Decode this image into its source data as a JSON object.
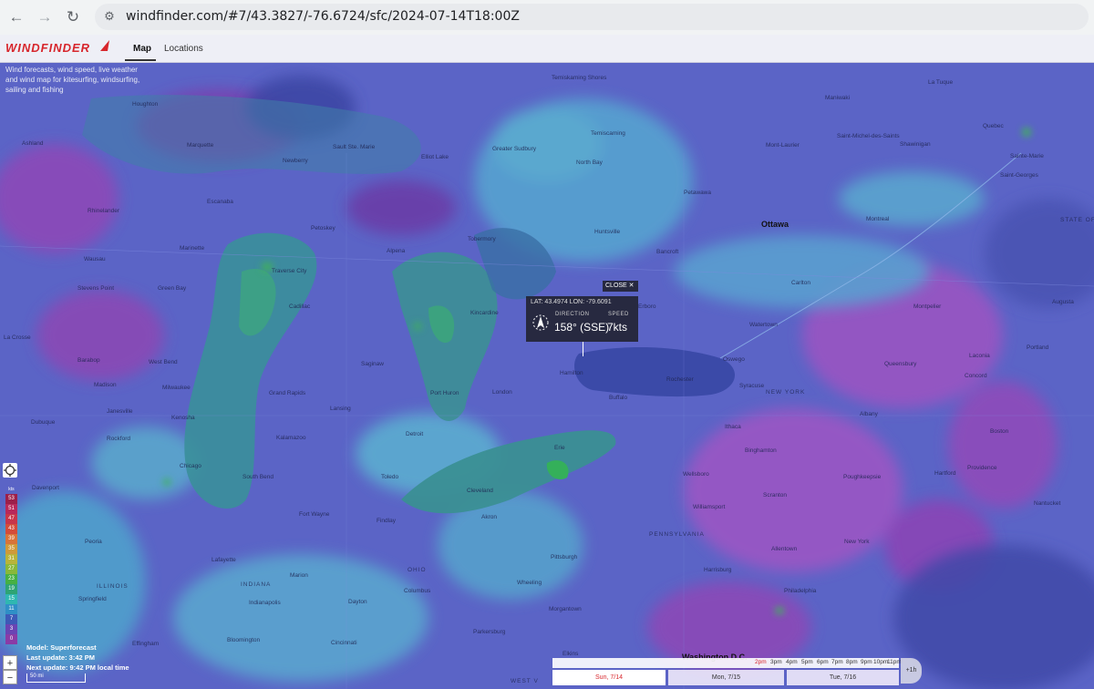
{
  "browser": {
    "back": "←",
    "forward": "→",
    "reload": "↻",
    "url": "windfinder.com/#7/43.3827/-76.6724/sfc/2024-07-14T18:00Z"
  },
  "header": {
    "logo": "WINDFINDER",
    "nav": [
      "Map",
      "Locations"
    ],
    "tagline": "Wind forecasts, wind speed, live weather and wind map for kitesurfing, windsurfing, sailing and fishing"
  },
  "popup": {
    "close": "CLOSE ✕",
    "latlon": "LAT: 43.4974  LON: -79.6091",
    "direction_label": "DIRECTION",
    "speed_label": "SPEED",
    "direction": "158° (SSE)",
    "speed": "7kts"
  },
  "cities": [
    [
      "Houghton",
      145,
      111
    ],
    [
      "Ashland",
      24,
      154
    ],
    [
      "Marquette",
      205,
      156
    ],
    [
      "Newberry",
      310,
      173
    ],
    [
      "Sault Ste. Marie",
      365,
      158
    ],
    [
      "Elliot Lake",
      462,
      169
    ],
    [
      "Greater Sudbury",
      540,
      160
    ],
    [
      "Temiskaming Shores",
      605,
      82
    ],
    [
      "Temiscaming",
      648,
      143
    ],
    [
      "North Bay",
      632,
      175
    ],
    [
      "Mont-Laurier",
      840,
      156
    ],
    [
      "Maniwaki",
      905,
      104
    ],
    [
      "La Tuque",
      1018,
      87
    ],
    [
      "Saint-Michel-des-Saints",
      918,
      146
    ],
    [
      "Shawinigan",
      987,
      155
    ],
    [
      "Quebec",
      1078,
      135
    ],
    [
      "Sainte-Marie",
      1108,
      168
    ],
    [
      "Saint-Georges",
      1097,
      189
    ],
    [
      "Escanaba",
      227,
      218
    ],
    [
      "Rhinelander",
      96,
      228
    ],
    [
      "Petoskey",
      341,
      247
    ],
    [
      "Alpena",
      424,
      272
    ],
    [
      "Tobermory",
      513,
      259
    ],
    [
      "Huntsville",
      652,
      251
    ],
    [
      "Petawawa",
      750,
      208
    ],
    [
      "Bancroft",
      720,
      273
    ],
    [
      "Montreal",
      950,
      237
    ],
    [
      "Marinette",
      197,
      269
    ],
    [
      "Wausau",
      92,
      281
    ],
    [
      "Traverse City",
      298,
      294
    ],
    [
      "Green Bay",
      173,
      313
    ],
    [
      "Stevens Point",
      85,
      313
    ],
    [
      "Cadillac",
      317,
      333
    ],
    [
      "Kincardine",
      516,
      340
    ],
    [
      "Carlton",
      868,
      307
    ],
    [
      "Watertown",
      822,
      353
    ],
    [
      "Montpelier",
      1002,
      333
    ],
    [
      "Augusta",
      1154,
      328
    ],
    [
      "La Crosse",
      4,
      367
    ],
    [
      "Barabop",
      85,
      392
    ],
    [
      "West Bend",
      163,
      394
    ],
    [
      "Saginaw",
      396,
      396
    ],
    [
      "Oswego",
      793,
      391
    ],
    [
      "Laconia",
      1063,
      387
    ],
    [
      "Portland",
      1126,
      378
    ],
    [
      "Rochester",
      731,
      413
    ],
    [
      "Queensbury",
      970,
      396
    ],
    [
      "Hamilton",
      614,
      406
    ],
    [
      "Madison",
      103,
      419
    ],
    [
      "Milwaukee",
      178,
      422
    ],
    [
      "Grand Rapids",
      295,
      428
    ],
    [
      "Port Huron",
      472,
      428
    ],
    [
      "London",
      540,
      427
    ],
    [
      "Buffalo",
      668,
      433
    ],
    [
      "Syracuse",
      811,
      420
    ],
    [
      "Concord",
      1058,
      409
    ],
    [
      "Janesville",
      117,
      448
    ],
    [
      "Kenosha",
      188,
      455
    ],
    [
      "Lansing",
      362,
      445
    ],
    [
      "Ithaca",
      795,
      465
    ],
    [
      "Albany",
      943,
      451
    ],
    [
      "Dubuque",
      34,
      460
    ],
    [
      "Rockford",
      117,
      478
    ],
    [
      "Kalamazoo",
      303,
      477
    ],
    [
      "Detroit",
      445,
      473
    ],
    [
      "Erie",
      608,
      488
    ],
    [
      "Binghamton",
      817,
      491
    ],
    [
      "Boston",
      1086,
      470
    ],
    [
      "Chicago",
      197,
      508
    ],
    [
      "South Bend",
      266,
      520
    ],
    [
      "Toledo",
      418,
      520
    ],
    [
      "Wellsboro",
      749,
      517
    ],
    [
      "Poughkeepsie",
      925,
      520
    ],
    [
      "Hartford",
      1025,
      516
    ],
    [
      "Providence",
      1061,
      510
    ],
    [
      "Davenport",
      35,
      532
    ],
    [
      "Cleveland",
      512,
      535
    ],
    [
      "Scranton",
      837,
      540
    ],
    [
      "Nantucket",
      1134,
      549
    ],
    [
      "Williamsport",
      760,
      553
    ],
    [
      "Fort Wayne",
      328,
      561
    ],
    [
      "Akron",
      528,
      564
    ],
    [
      "Findlay",
      413,
      568
    ],
    [
      "Peoria",
      93,
      591
    ],
    [
      "Allentown",
      846,
      599
    ],
    [
      "New York",
      926,
      591
    ],
    [
      "Pittsburgh",
      604,
      608
    ],
    [
      "Lafayette",
      232,
      611
    ],
    [
      "Marion",
      318,
      628
    ],
    [
      "Harrisburg",
      772,
      622
    ],
    [
      "Wheeling",
      567,
      636
    ],
    [
      "Columbus",
      443,
      645
    ],
    [
      "Philadelphia",
      860,
      645
    ],
    [
      "Springfield",
      86,
      654
    ],
    [
      "Indianapolis",
      273,
      658
    ],
    [
      "Dayton",
      382,
      657
    ],
    [
      "Morgantown",
      602,
      665
    ],
    [
      "Effingham",
      145,
      703
    ],
    [
      "Bloomington",
      249,
      699
    ],
    [
      "Cincinnati",
      363,
      702
    ],
    [
      "Parkersburg",
      519,
      690
    ],
    [
      "Elkins",
      617,
      714
    ],
    [
      "Erboro",
      700,
      333
    ]
  ],
  "big_cities": [
    [
      "Ottawa",
      835,
      241
    ],
    [
      "Washington D.C.",
      748,
      716
    ]
  ],
  "states": [
    [
      "NEW YORK",
      840,
      427
    ],
    [
      "PENNSYLVANIA",
      712,
      583
    ],
    [
      "ILLINOIS",
      106,
      640
    ],
    [
      "INDIANA",
      264,
      638
    ],
    [
      "OHIO",
      447,
      622
    ],
    [
      "STATE OF",
      1163,
      238
    ],
    [
      "WEST V",
      560,
      744
    ]
  ],
  "legend": {
    "unit": "kts",
    "values": [
      "53",
      "51",
      "47",
      "43",
      "39",
      "35",
      "31",
      "27",
      "23",
      "19",
      "15",
      "11",
      "7",
      "3",
      "0"
    ],
    "colors": [
      "#9c1f4a",
      "#b8285a",
      "#c8354a",
      "#d44c3a",
      "#d8743a",
      "#cf9a3a",
      "#b8b43a",
      "#88b83a",
      "#46b043",
      "#2ea474",
      "#2fb7b1",
      "#2f8fc6",
      "#3d5ab7",
      "#6a44b3",
      "#8a3ba6"
    ]
  },
  "zoom": {
    "in": "+",
    "out": "−"
  },
  "model": {
    "line1": "Model: Superforecast",
    "line2": "Last update: 3:42 PM",
    "line3": "Next update: 9:42 PM local time",
    "scale": "50 mi"
  },
  "timeline": {
    "hours": [
      "2pm",
      "3pm",
      "4pm",
      "5pm",
      "6pm",
      "7pm",
      "8pm",
      "9pm",
      "10pm",
      "11pm"
    ],
    "days": [
      "Sun, 7/14",
      "Mon, 7/15",
      "Tue, 7/16"
    ],
    "step": "+1h"
  }
}
